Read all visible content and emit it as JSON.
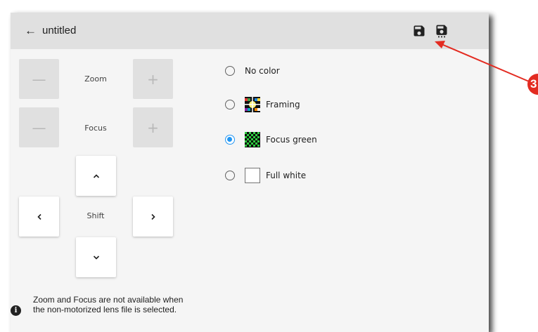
{
  "header": {
    "back_arrow": "←",
    "title": "untitled",
    "icons": [
      "save-icon",
      "save-as-icon"
    ]
  },
  "controls": {
    "zoom": {
      "label": "Zoom",
      "minus": "—",
      "plus": "+"
    },
    "focus": {
      "label": "Focus",
      "minus": "—",
      "plus": "+"
    },
    "shift": {
      "label": "Shift",
      "up": "^",
      "down": "v",
      "left": "<",
      "right": ">"
    }
  },
  "patterns": {
    "options": [
      {
        "label": "No color",
        "checked": false
      },
      {
        "label": "Framing",
        "checked": false
      },
      {
        "label": "Focus green",
        "checked": true
      },
      {
        "label": "Full white",
        "checked": false
      }
    ]
  },
  "info": {
    "text": "Zoom and Focus are not available when the non-motorized lens file is selected."
  },
  "callout": {
    "number": "3",
    "color": "#e32b21"
  },
  "colors": {
    "accent": "#2196f3",
    "topbar": "#e0e0e0",
    "panel": "#f5f5f5"
  }
}
